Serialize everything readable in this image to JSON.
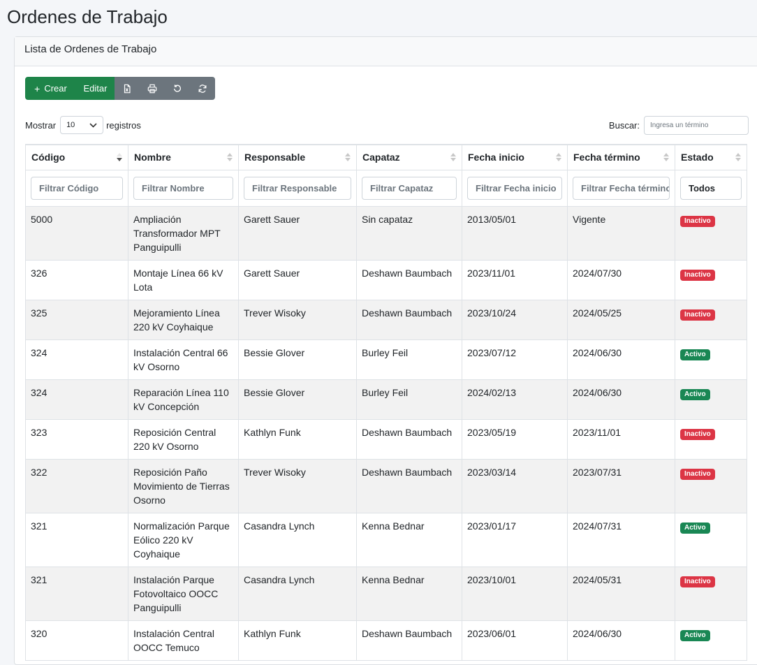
{
  "page_title": "Ordenes de Trabajo",
  "card_title": "Lista de Ordenes de Trabajo",
  "toolbar": {
    "create_label": "Crear",
    "edit_label": "Editar",
    "excel_icon": "file-excel-icon",
    "print_icon": "printer-icon",
    "reset_icon": "rotate-ccw-icon",
    "refresh_icon": "refresh-icon"
  },
  "length": {
    "prefix": "Mostrar",
    "value": "10",
    "suffix": "registros"
  },
  "search": {
    "label": "Buscar:",
    "placeholder": "Ingresa un término"
  },
  "columns": [
    "Código",
    "Nombre",
    "Responsable",
    "Capataz",
    "Fecha inicio",
    "Fecha término",
    "Estado"
  ],
  "filters": [
    "Filtrar Código",
    "Filtrar Nombre",
    "Filtrar Responsable",
    "Filtrar Capataz",
    "Filtrar Fecha inicio",
    "Filtrar Fecha término",
    "Todos"
  ],
  "rows": [
    {
      "codigo": "5000",
      "nombre": "Ampliación Transformador MPT Panguipulli",
      "responsable": "Garett Sauer",
      "capataz": "Sin capataz",
      "inicio": "2013/05/01",
      "termino": "Vigente",
      "estado": "Inactivo"
    },
    {
      "codigo": "326",
      "nombre": "Montaje Línea 66 kV Lota",
      "responsable": "Garett Sauer",
      "capataz": "Deshawn Baumbach",
      "inicio": "2023/11/01",
      "termino": "2024/07/30",
      "estado": "Inactivo"
    },
    {
      "codigo": "325",
      "nombre": "Mejoramiento Línea 220 kV Coyhaique",
      "responsable": "Trever Wisoky",
      "capataz": "Deshawn Baumbach",
      "inicio": "2023/10/24",
      "termino": "2024/05/25",
      "estado": "Inactivo"
    },
    {
      "codigo": "324",
      "nombre": "Instalación Central 66 kV Osorno",
      "responsable": "Bessie Glover",
      "capataz": "Burley Feil",
      "inicio": "2023/07/12",
      "termino": "2024/06/30",
      "estado": "Activo"
    },
    {
      "codigo": "324",
      "nombre": "Reparación Línea 110 kV Concepción",
      "responsable": "Bessie Glover",
      "capataz": "Burley Feil",
      "inicio": "2024/02/13",
      "termino": "2024/06/30",
      "estado": "Activo"
    },
    {
      "codigo": "323",
      "nombre": "Reposición Central 220 kV Osorno",
      "responsable": "Kathlyn Funk",
      "capataz": "Deshawn Baumbach",
      "inicio": "2023/05/19",
      "termino": "2023/11/01",
      "estado": "Inactivo"
    },
    {
      "codigo": "322",
      "nombre": "Reposición Paño Movimiento de Tierras Osorno",
      "responsable": "Trever Wisoky",
      "capataz": "Deshawn Baumbach",
      "inicio": "2023/03/14",
      "termino": "2023/07/31",
      "estado": "Inactivo"
    },
    {
      "codigo": "321",
      "nombre": "Normalización Parque Eólico 220 kV Coyhaique",
      "responsable": "Casandra Lynch",
      "capataz": "Kenna Bednar",
      "inicio": "2023/01/17",
      "termino": "2024/07/31",
      "estado": "Activo"
    },
    {
      "codigo": "321",
      "nombre": "Instalación Parque Fotovoltaico OOCC Panguipulli",
      "responsable": "Casandra Lynch",
      "capataz": "Kenna Bednar",
      "inicio": "2023/10/01",
      "termino": "2024/05/31",
      "estado": "Inactivo"
    },
    {
      "codigo": "320",
      "nombre": "Instalación Central OOCC Temuco",
      "responsable": "Kathlyn Funk",
      "capataz": "Deshawn Baumbach",
      "inicio": "2023/06/01",
      "termino": "2024/06/30",
      "estado": "Activo"
    }
  ],
  "colors": {
    "green": "#1e8449",
    "gray": "#6c757d",
    "badge_inactive": "#dc3545",
    "badge_active": "#198754"
  }
}
